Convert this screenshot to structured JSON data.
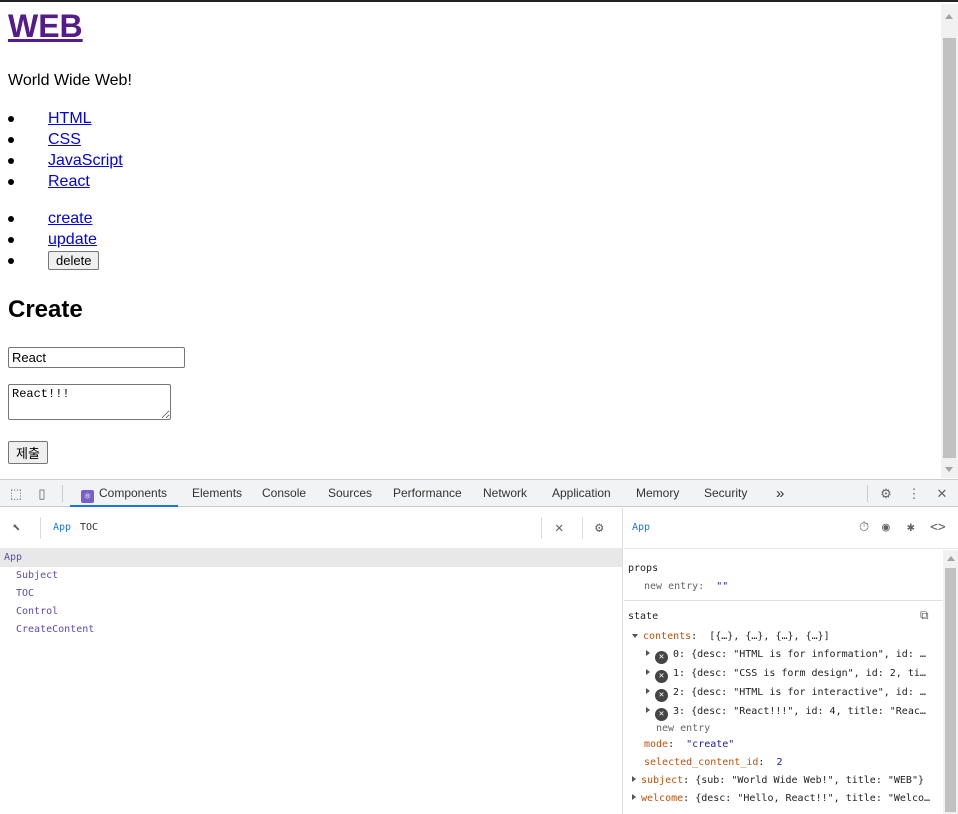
{
  "page": {
    "title": "WEB",
    "subtitle": "World Wide Web!",
    "toc": [
      "HTML",
      "CSS",
      "JavaScript",
      "React"
    ],
    "control": {
      "create": "create",
      "update": "update",
      "delete": "delete"
    },
    "create_heading": "Create",
    "form": {
      "title_value": "React",
      "desc_value": "React!!!",
      "submit_label": "제출"
    }
  },
  "devtools": {
    "tabs": [
      "Components",
      "Elements",
      "Console",
      "Sources",
      "Performance",
      "Network",
      "Application",
      "Memory",
      "Security"
    ],
    "active_tab": "Components",
    "more_tabs": "»",
    "tree": {
      "breadcrumb": [
        "App",
        "TOC"
      ],
      "nodes": [
        "App",
        "Subject",
        "TOC",
        "Control",
        "CreateContent"
      ],
      "selected": "App"
    },
    "inspector": {
      "component": "App",
      "props_title": "props",
      "props_new_entry": "new entry",
      "props_new_entry_value": "\"\"",
      "state_title": "state",
      "contents_key": "contents",
      "contents_summary": "[{…}, {…}, {…}, {…}]",
      "contents_items": [
        {
          "index": "0",
          "value": "{desc: \"HTML is for information\", id: …"
        },
        {
          "index": "1",
          "value": "{desc: \"CSS is form design\", id: 2, ti…"
        },
        {
          "index": "2",
          "value": "{desc: \"HTML is for interactive\", id: …"
        },
        {
          "index": "3",
          "value": "{desc: \"React!!!\", id: 4, title: \"Reac…"
        }
      ],
      "contents_new_entry": "new entry",
      "mode_key": "mode",
      "mode_value": "\"create\"",
      "selected_key": "selected_content_id",
      "selected_value": "2",
      "subject_key": "subject",
      "subject_value": "{sub: \"World Wide Web!\", title: \"WEB\"}",
      "welcome_key": "welcome",
      "welcome_value": "{desc: \"Hello, React!!\", title: \"Welco…"
    }
  },
  "colors": {
    "accent": "#1a73e8",
    "visited_link": "#551a8b",
    "link": "#0000ee",
    "react_purple": "#7a5fc8"
  }
}
